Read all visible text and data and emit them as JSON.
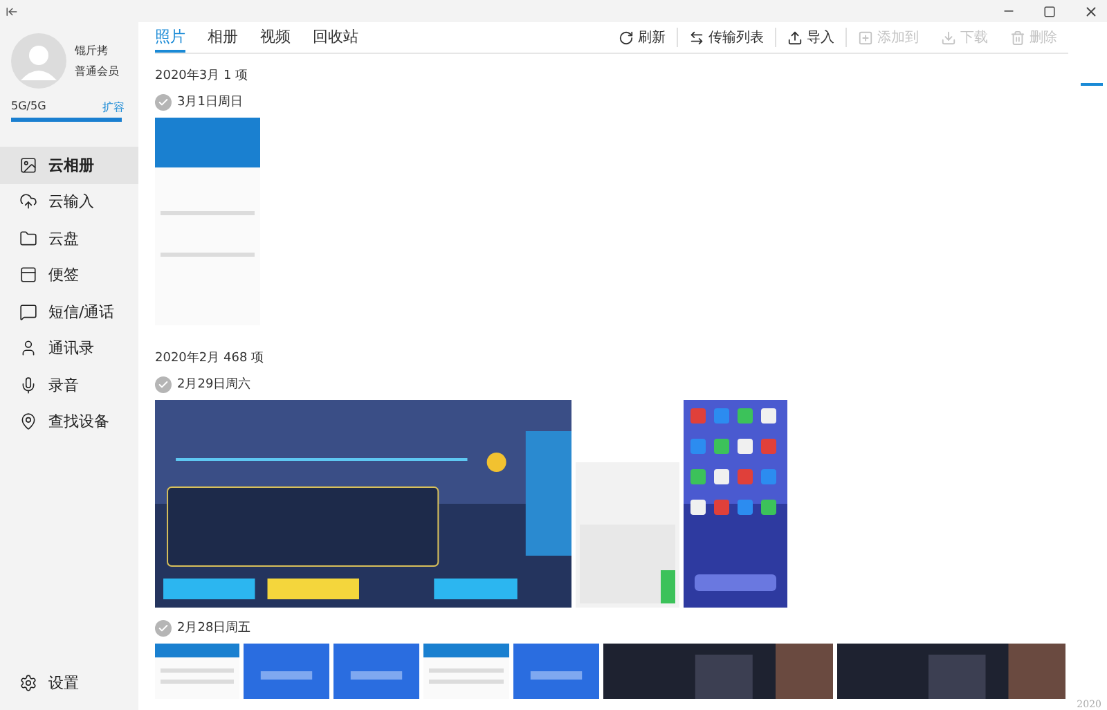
{
  "user": {
    "name": "锟斤拷",
    "membership": "普通会员"
  },
  "storage": {
    "used": "5G/5G",
    "level": 1.0,
    "expand_link": "扩容"
  },
  "sidebar": {
    "items": [
      {
        "label": "云相册",
        "selected": true
      },
      {
        "label": "云输入",
        "selected": false
      },
      {
        "label": "云盘",
        "selected": false
      },
      {
        "label": "便签",
        "selected": false
      },
      {
        "label": "短信/通话",
        "selected": false
      },
      {
        "label": "通讯录",
        "selected": false
      },
      {
        "label": "录音",
        "selected": false
      },
      {
        "label": "查找设备",
        "selected": false
      }
    ],
    "settings": "设置"
  },
  "tabs": [
    {
      "label": "照片",
      "selected": true
    },
    {
      "label": "相册",
      "selected": false
    },
    {
      "label": "视频",
      "selected": false
    },
    {
      "label": "回收站",
      "selected": false
    }
  ],
  "toolbar": [
    {
      "label": "刷新",
      "disabled": false
    },
    {
      "label": "传输列表",
      "disabled": false
    },
    {
      "label": "导入",
      "disabled": false
    },
    {
      "label": "添加到",
      "disabled": true
    },
    {
      "label": "下载",
      "disabled": true
    },
    {
      "label": "删除",
      "disabled": true
    }
  ],
  "months": [
    {
      "title": "2020年3月 1 项",
      "days": [
        {
          "date": "3月1日周日"
        }
      ]
    },
    {
      "title": "2020年2月 468 项",
      "days": [
        {
          "date": "2月29日周六"
        },
        {
          "date": "2月28日周五"
        }
      ]
    }
  ],
  "timeline": {
    "year": "2020"
  }
}
